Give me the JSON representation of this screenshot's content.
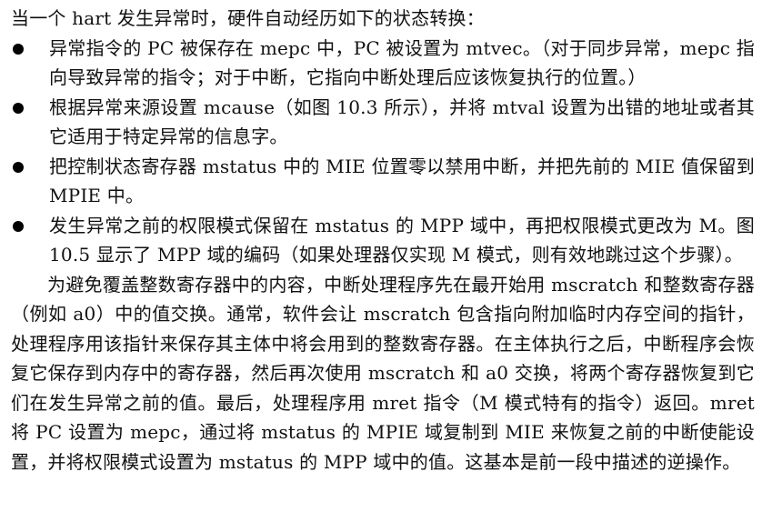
{
  "intro": "当一个 hart 发生异常时，硬件自动经历如下的状态转换：",
  "bullets": [
    "异常指令的 PC 被保存在 mepc 中，PC 被设置为 mtvec。（对于同步异常，mepc 指向导致异常的指令；对于中断，它指向中断处理后应该恢复执行的位置。）",
    "根据异常来源设置 mcause（如图 10.3 所示），并将 mtval 设置为出错的地址或者其它适用于特定异常的信息字。",
    "把控制状态寄存器 mstatus 中的 MIE 位置零以禁用中断，并把先前的 MIE 值保留到 MPIE 中。",
    "发生异常之前的权限模式保留在 mstatus 的 MPP 域中，再把权限模式更改为 M。图 10.5 显示了 MPP 域的编码（如果处理器仅实现 M 模式，则有效地跳过这个步骤）。"
  ],
  "paragraph": "为避免覆盖整数寄存器中的内容，中断处理程序先在最开始用 mscratch 和整数寄存器（例如 a0）中的值交换。通常，软件会让 mscratch 包含指向附加临时内存空间的指针，处理程序用该指针来保存其主体中将会用到的整数寄存器。在主体执行之后，中断程序会恢复它保存到内存中的寄存器，然后再次使用 mscratch 和 a0 交换，将两个寄存器恢复到它们在发生异常之前的值。最后，处理程序用 mret 指令（M 模式特有的指令）返回。mret 将 PC 设置为 mepc，通过将 mstatus 的 MPIE 域复制到 MIE 来恢复之前的中断使能设置，并将权限模式设置为 mstatus 的 MPP 域中的值。这基本是前一段中描述的逆操作。"
}
